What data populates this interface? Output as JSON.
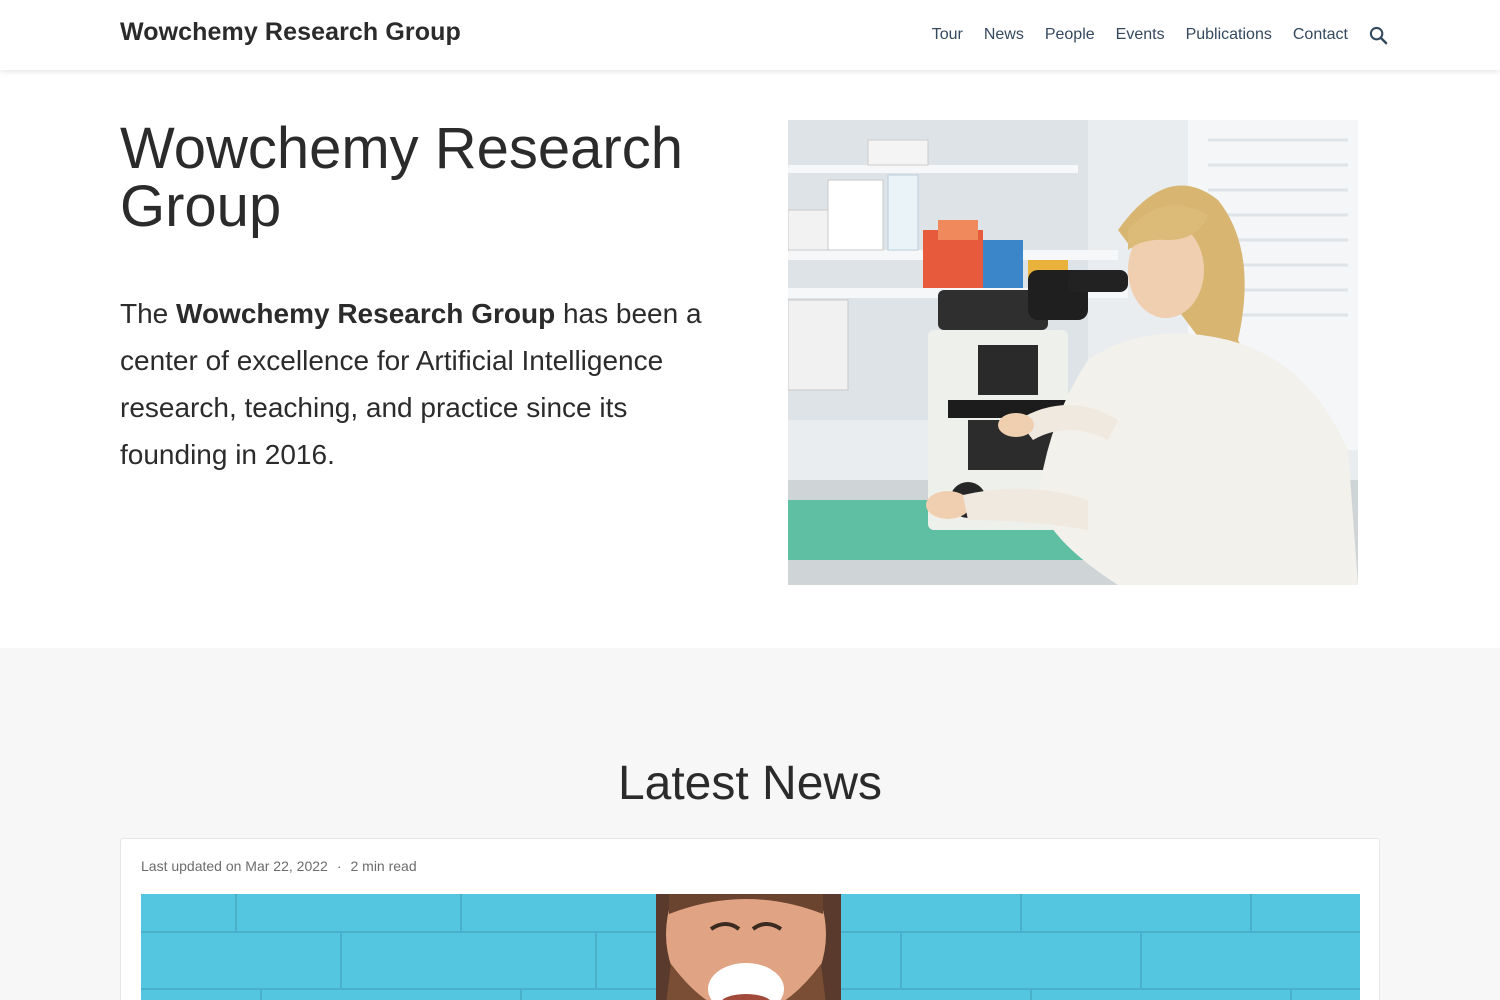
{
  "navbar": {
    "brand": "Wowchemy Research Group",
    "links": [
      "Tour",
      "News",
      "People",
      "Events",
      "Publications",
      "Contact"
    ],
    "search_icon": "search-icon"
  },
  "hero": {
    "title": "Wowchemy Research Group",
    "text_prefix": "The ",
    "text_bold": "Wowchemy Research Group",
    "text_suffix": " has been a center of excellence for Artificial Intelligence research, teaching, and practice since its founding in 2016.",
    "image": "scientist-at-microscope-photo"
  },
  "news": {
    "section_title": "Latest News",
    "card": {
      "updated": "Last updated on Mar 22, 2022",
      "separator": "·",
      "read_time": "2 min read",
      "image": "laughing-man-blue-wall-photo"
    }
  },
  "colors": {
    "text": "#2b2b2b",
    "nav_link": "#34495e",
    "section_bg": "#f7f7f7",
    "meta_text": "#6c6c6c"
  }
}
